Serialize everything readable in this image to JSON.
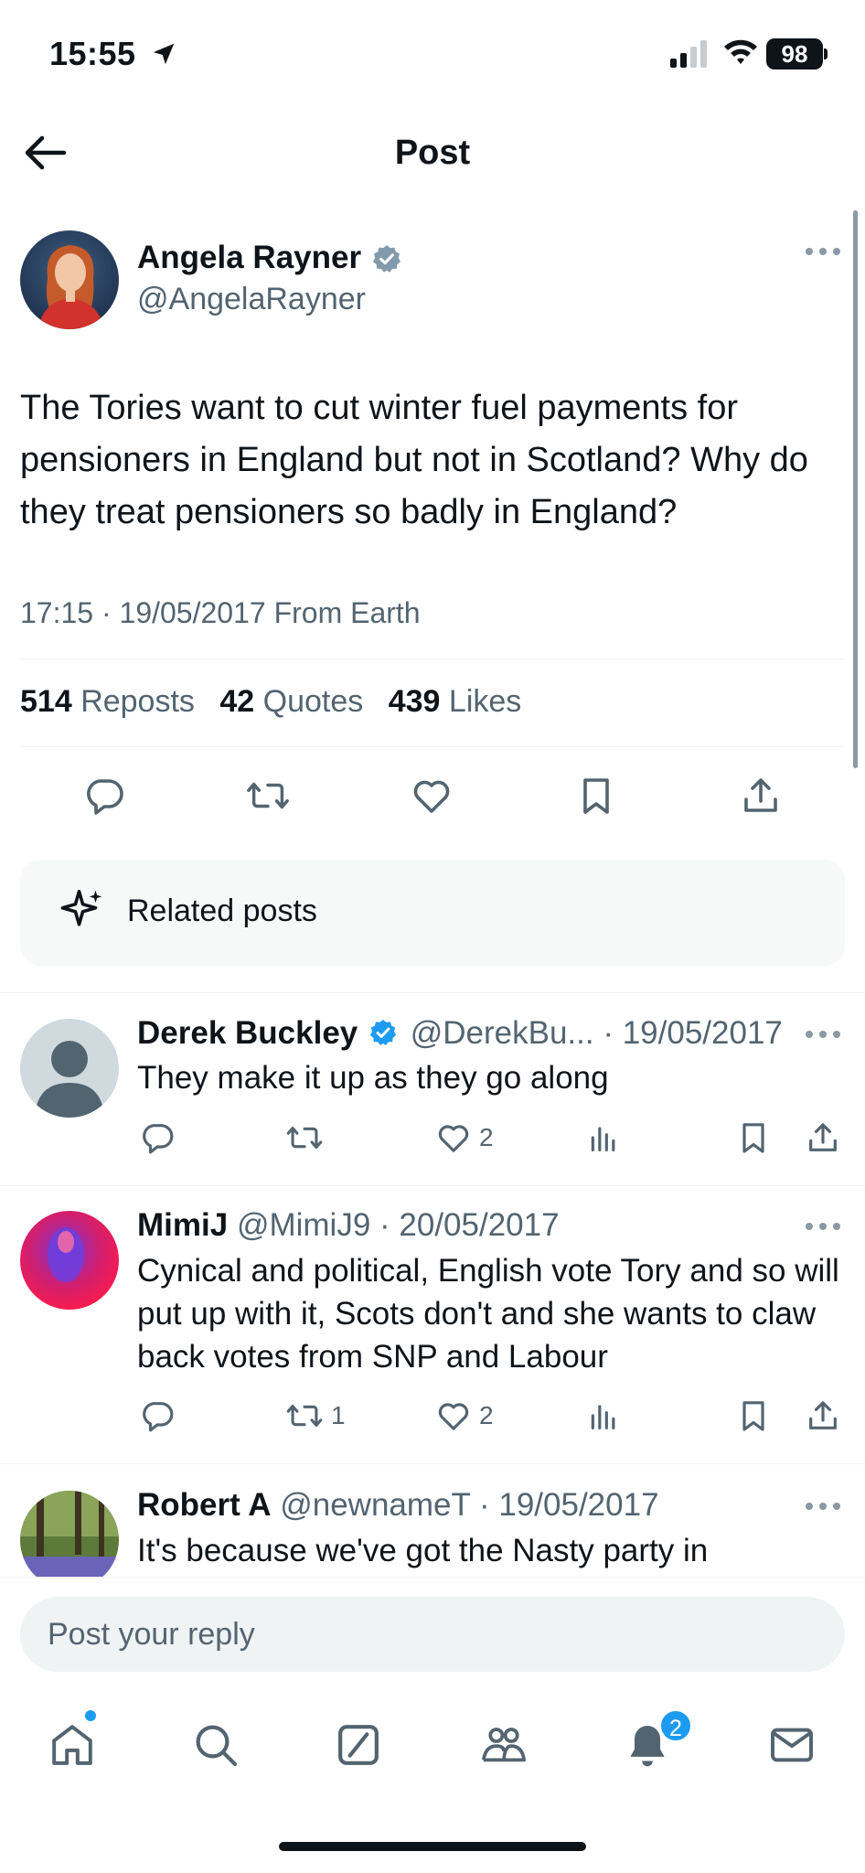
{
  "status_bar": {
    "time": "15:55",
    "battery": "98"
  },
  "header": {
    "title": "Post"
  },
  "tweet": {
    "author_name": "Angela Rayner",
    "author_handle": "@AngelaRayner",
    "text": "The Tories want to cut winter fuel payments for pensioners in England but not in Scotland? Why do they treat pensioners so badly in England?",
    "meta": "17:15 · 19/05/2017 From Earth",
    "stats": {
      "reposts_count": "514",
      "reposts_label": "Reposts",
      "quotes_count": "42",
      "quotes_label": "Quotes",
      "likes_count": "439",
      "likes_label": "Likes"
    }
  },
  "related": {
    "label": "Related posts"
  },
  "replies": [
    {
      "name": "Derek Buckley",
      "handle_date": "@DerekBu... · 19/05/2017",
      "text": "They make it up as they go along",
      "reposts": "",
      "likes": "2"
    },
    {
      "name": "MimiJ",
      "handle_date": "@MimiJ9 · 20/05/2017",
      "text": "Cynical and political, English vote Tory and so will put up with it,  Scots don't and she wants to claw back votes from SNP and Labour",
      "reposts": "1",
      "likes": "2"
    },
    {
      "name": "Robert A",
      "handle_date": "@newnameT · 19/05/2017",
      "text": "It's because we've got the Nasty party in"
    }
  ],
  "reply_bar": {
    "placeholder": "Post your reply"
  },
  "tab_bar": {
    "notifications_badge": "2"
  },
  "icons": [
    "location-arrow-icon",
    "signal-icon",
    "wifi-icon",
    "back-arrow-icon",
    "verified-icon",
    "more-icon",
    "reply-icon",
    "repost-icon",
    "like-icon",
    "bookmark-icon",
    "share-icon",
    "sparkle-icon",
    "views-icon",
    "home-icon",
    "search-icon",
    "grok-icon",
    "communities-icon",
    "notifications-icon",
    "messages-icon"
  ],
  "colors": {
    "accent": "#1d9bf0",
    "text": "#0f1419",
    "muted": "#536471"
  }
}
